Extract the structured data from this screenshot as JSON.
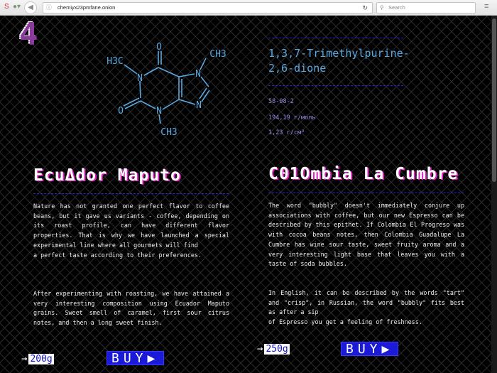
{
  "browser": {
    "url": "chemiyx23pmfane.onion",
    "search_placeholder": "Search"
  },
  "page": {
    "section_number": "4",
    "molecule": {
      "labels": {
        "o_top": "O",
        "o_left": "O",
        "h3c_left": "H3C",
        "ch3_top": "CH3",
        "ch3_bottom": "CH3",
        "n1": "N",
        "n3": "N",
        "n7": "N",
        "n9": "N"
      }
    },
    "compound": {
      "name_line1": "1,3,7-Trimethylpurine-",
      "name_line2": "2,6-dione",
      "cas": "58-08-2",
      "molar_mass": "194,19 г/моль",
      "density": "1,23 г/см³"
    },
    "products": [
      {
        "title": "EcuΔdor Maputo",
        "paragraph1": "Nature has not granted one perfect flavor to coffee beans, but it gave us variants - coffee, depending on its roast profile, can have different flavor properties. That is why we have launched a special experimental line where all gourmets will find\na perfect taste according to their preferences.",
        "paragraph2": "After experimenting with roasting, we have attained a very interesting composition using Ecuador Maputo grains. Sweet smell of caramel, first sour citrus notes, and then a long sweet finish.",
        "weight": "200g",
        "buy_label": "BUY"
      },
      {
        "title": "C01Ombia La Cumbre",
        "paragraph1": "The word \"bubbly\" doesn't immediately conjure up associations with coffee, but our new Espresso can be described by this epithet. If Colombia El Progreso was with cocoa beans notes, then Colombia Guadalupe La Cumbre has wine sour taste, sweet fruity aroma and a very interesting light base that leaves you with a taste of soda bubbles.",
        "paragraph2": "In English, it can be described by the words \"tart\" and \"crisp\", in Russian, the word \"bubbly\" fits best as after a sip\nof Espresso you get a feeling of freshness.",
        "weight": "250g",
        "buy_label": "BUY"
      }
    ]
  }
}
